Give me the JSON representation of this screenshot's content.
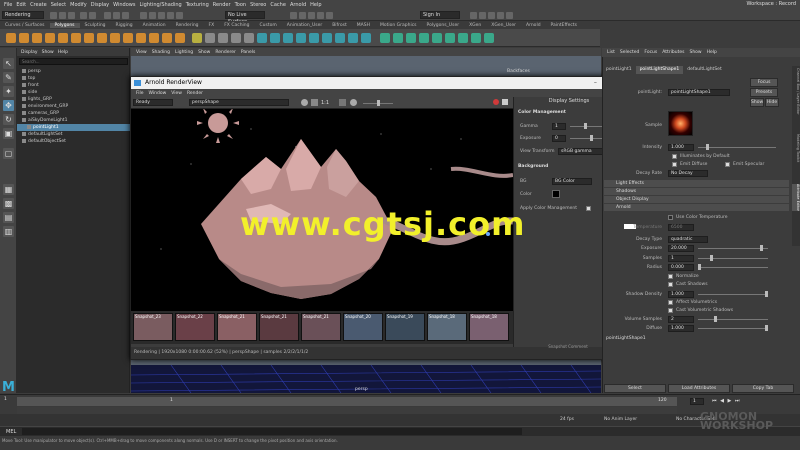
{
  "menubar": {
    "items": [
      "File",
      "Edit",
      "Create",
      "Select",
      "Modify",
      "Display",
      "Windows",
      "Lighting/Shading",
      "Texturing",
      "Render",
      "Toon",
      "Stereo",
      "Cache",
      "Arnold",
      "Help"
    ],
    "workspace_label": "Workspace :",
    "workspace_value": "Record"
  },
  "statusline": {
    "mode": "Rendering",
    "live_surface": "No Live Surface",
    "sign_in": "Sign In",
    "val_a": "0.00",
    "val_b": "1.00",
    "color_space": "sRGB gamma"
  },
  "shelf": {
    "tabs": [
      "Curves / Surfaces",
      "Polygons",
      "Sculpting",
      "Rigging",
      "Animation",
      "Rendering",
      "FX",
      "FX Caching",
      "Custom",
      "Animation_User",
      "Bifrost",
      "MASH",
      "Motion Graphics",
      "Polygons_User",
      "XGen",
      "XGen_User",
      "Arnold",
      "PaintEffects"
    ],
    "active": 1
  },
  "outliner": {
    "menu": [
      "Display",
      "Show",
      "Help"
    ],
    "search_placeholder": "Search...",
    "items": [
      {
        "label": "persp",
        "selected": false,
        "indent": 1
      },
      {
        "label": "top",
        "selected": false,
        "indent": 1
      },
      {
        "label": "front",
        "selected": false,
        "indent": 1
      },
      {
        "label": "side",
        "selected": false,
        "indent": 1
      },
      {
        "label": "lights_GRP",
        "selected": false,
        "indent": 1
      },
      {
        "label": "environment_GRP",
        "selected": false,
        "indent": 1
      },
      {
        "label": "cameras_GRP",
        "selected": false,
        "indent": 1
      },
      {
        "label": "aiSkyDomeLight1",
        "selected": false,
        "indent": 1
      },
      {
        "label": "pointLight1",
        "selected": true,
        "indent": 2
      },
      {
        "label": "defaultLightSet",
        "selected": false,
        "indent": 1
      },
      {
        "label": "defaultObjectSet",
        "selected": false,
        "indent": 1
      }
    ]
  },
  "viewport": {
    "menu": [
      "View",
      "Shading",
      "Lighting",
      "Show",
      "Renderer",
      "Panels"
    ],
    "camera_label": "persp",
    "header_right": "Backfaces"
  },
  "renderview": {
    "title": "Arnold RenderView",
    "menu": [
      "File",
      "Window",
      "View",
      "Render"
    ],
    "state": "Ready",
    "camera": "perspShape",
    "ratio": "1:1",
    "status": "Rendering | 1920x1080 0:00:00.62 (52%) | perspShape | samples 2/2/2/1/1/2",
    "snapshot_comment": "Snapshot Comment",
    "snapshots": [
      "Snapshot_23",
      "Snapshot_22",
      "Snapshot_21",
      "Snapshot_21",
      "Snapshot_21",
      "Snapshot_20",
      "Snapshot_19",
      "Snapshot_18",
      "Snapshot_18"
    ],
    "display_settings": {
      "title": "Display Settings",
      "color_mgmt": "Color Management",
      "gamma_label": "Gamma",
      "gamma_value": "1",
      "exposure_label": "Exposure",
      "exposure_value": "0",
      "view_transform_label": "View Transform",
      "view_transform_value": "sRGB gamma",
      "background": "Background",
      "bg_label": "BG",
      "bg_value": "BG Color",
      "color_label": "Color",
      "apply_cm": "Apply Color Management"
    }
  },
  "attribute_editor": {
    "menu": [
      "List",
      "Selected",
      "Focus",
      "Attributes",
      "Show",
      "Help"
    ],
    "tabs": [
      "pointLight1",
      "pointLightShape1",
      "defaultLightSet"
    ],
    "active_tab": 1,
    "node_label": "pointLight:",
    "node_value": "pointLightShape1",
    "focus": "Focus",
    "presets": "Presets",
    "show": "Show",
    "hide": "Hide",
    "sample_label": "Sample",
    "intensity_label": "Intensity",
    "intensity_value": "1.000",
    "illum_default": "Illuminates by Default",
    "emit_diffuse": "Emit Diffuse",
    "emit_specular": "Emit Specular",
    "decay_rate_label": "Decay Rate",
    "decay_rate_value": "No Decay",
    "sections": [
      "Light Effects",
      "Shadows",
      "Object Display",
      "Arnold"
    ],
    "use_color_temp": "Use Color Temperature",
    "temperature_label": "Temperature",
    "temperature_value": "6500",
    "decay_type_label": "Decay Type",
    "decay_type_value": "quadratic",
    "exposure_label": "Exposure",
    "exposure_value": "20.000",
    "samples_label": "Samples",
    "samples_value": "1",
    "radius_label": "Radius",
    "radius_value": "0.000",
    "normalize": "Normalize",
    "cast_shadows": "Cast Shadows",
    "shadow_density_label": "Shadow Density",
    "shadow_density_value": "1.000",
    "affect_volumetrics": "Affect Volumetrics",
    "cast_vol_shadows": "Cast Volumetric Shadows",
    "volume_samples_label": "Volume Samples",
    "volume_samples_value": "2",
    "diffuse_label": "Diffuse",
    "diffuse_value": "1.000",
    "footer_node": "pointLightShape1",
    "btn_select": "Select",
    "btn_load": "Load Attributes",
    "btn_copy": "Copy Tab"
  },
  "timeline": {
    "frame_a": "1",
    "frame_b": "1",
    "frame_c": "120",
    "no_anim_layer": "No Anim Layer",
    "no_char_set": "No Character Set",
    "fps": "24 fps"
  },
  "cmdline": {
    "label": "MEL"
  },
  "helpline": "Move Tool: Use manipulator to move object(s). Ctrl+MMB+drag to move components along normals. Use D or INSERT to change the pivot position and axis orientation.",
  "watermark": "www.cgtsj.com",
  "side_tabs": [
    "Channel Box / Layer Editor",
    "Modeling Toolkit",
    "Attribute Editor"
  ],
  "colors": {
    "selection": "#5285a6",
    "render_bg": "#000000",
    "terrain": "#c89a98",
    "watermark": "#f2f02b"
  }
}
